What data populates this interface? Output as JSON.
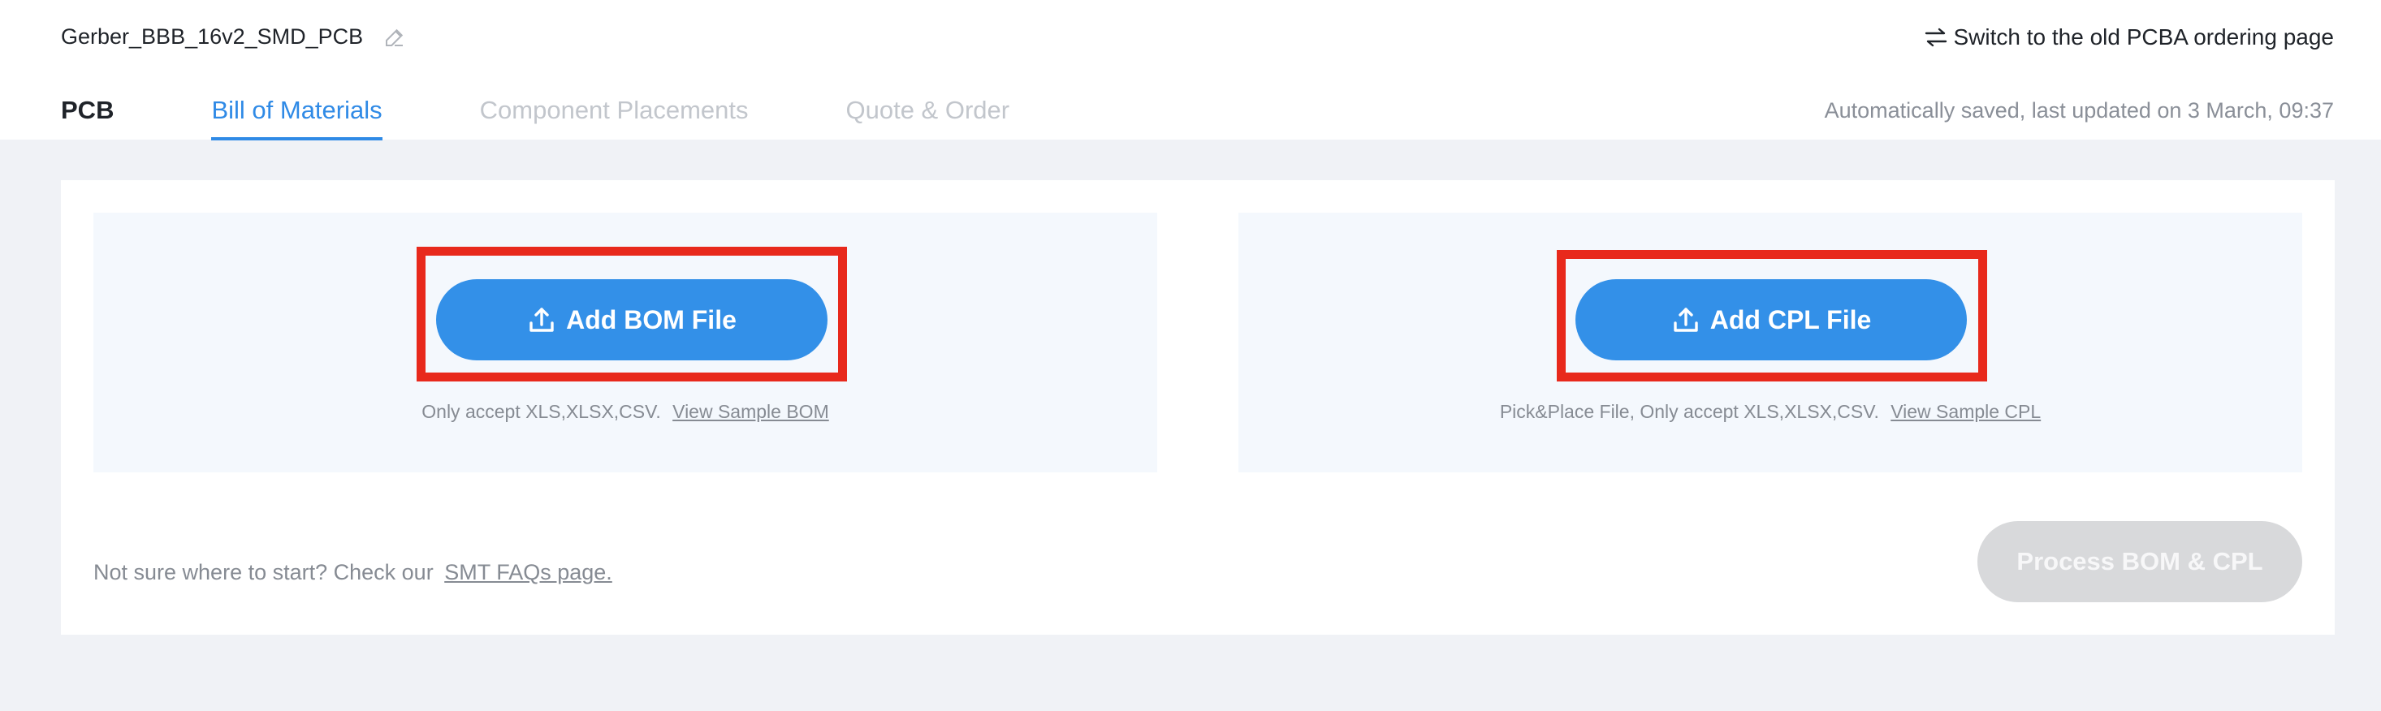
{
  "header": {
    "project_name": "Gerber_BBB_16v2_SMD_PCB",
    "switch_label": "Switch to the old PCBA ordering page",
    "saved_status": "Automatically saved, last updated on 3 March, 09:37"
  },
  "tabs": [
    {
      "label": "PCB",
      "state": "normal"
    },
    {
      "label": "Bill of Materials",
      "state": "active"
    },
    {
      "label": "Component Placements",
      "state": "disabled"
    },
    {
      "label": "Quote & Order",
      "state": "disabled"
    }
  ],
  "bom_upload": {
    "button_label": "Add BOM File",
    "hint": "Only accept XLS,XLSX,CSV.",
    "sample_link": "View Sample BOM"
  },
  "cpl_upload": {
    "button_label": "Add CPL File",
    "hint": "Pick&Place File, Only accept XLS,XLSX,CSV.",
    "sample_link": "View Sample CPL"
  },
  "footer": {
    "text": "Not sure where to start? Check our",
    "faq_link": "SMT FAQs page.",
    "process_label": "Process BOM & CPL"
  },
  "colors": {
    "accent": "#3390e8",
    "highlight": "#e8291c",
    "disabled_button": "#d8d9db"
  },
  "icons": [
    "edit-icon",
    "switch-icon",
    "upload-icon"
  ]
}
